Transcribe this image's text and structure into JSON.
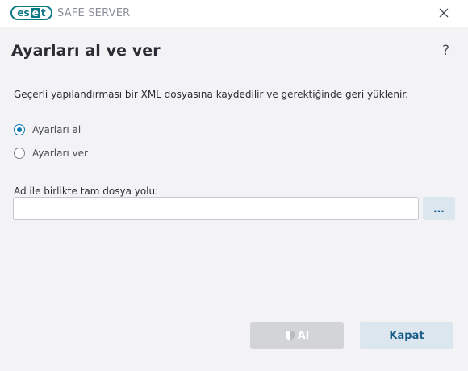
{
  "titlebar": {
    "logo_part1": "es",
    "logo_part2": "e",
    "logo_part3": "t",
    "product": "SAFE SERVER"
  },
  "header": {
    "title": "Ayarları al ve ver",
    "help": "?"
  },
  "description": "Geçerli yapılandırması bir XML dosyasına kaydedilir ve gerektiğinde geri yüklenir.",
  "options": [
    {
      "label": "Ayarları al",
      "checked": true
    },
    {
      "label": "Ayarları ver",
      "checked": false
    }
  ],
  "path": {
    "label": "Ad ile birlikte tam dosya yolu:",
    "value": "",
    "browse_label": "..."
  },
  "footer": {
    "import_label": "Al",
    "close_label": "Kapat"
  },
  "colors": {
    "brand": "#0b7a86",
    "accent": "#0b78b4",
    "secondary_button": "#dbe6ef",
    "disabled_button": "#d3d4d8"
  },
  "icons": [
    "close-icon",
    "help-icon",
    "shield-icon"
  ]
}
